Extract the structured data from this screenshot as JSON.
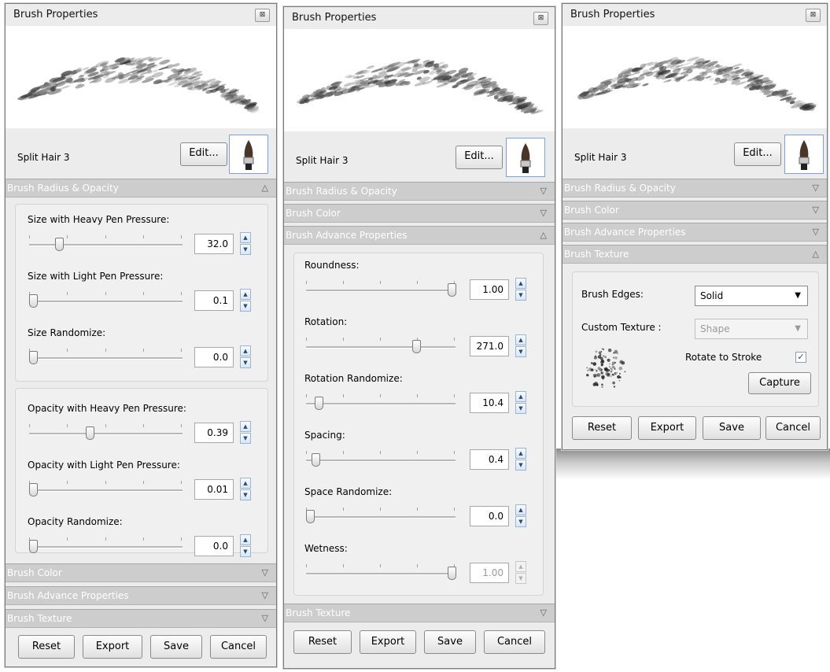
{
  "window_title": "Brush Properties",
  "brush_name": "Split Hair 3",
  "edit_label": "Edit...",
  "close_glyph": "⊠",
  "sections": {
    "radius": "Brush Radius & Opacity",
    "color": "Brush Color",
    "advance": "Brush Advance Properties",
    "texture": "Brush Texture"
  },
  "arrows": {
    "collapsed": "▽",
    "expanded": "△"
  },
  "buttons": {
    "reset": "Reset",
    "export": "Export",
    "save": "Save",
    "cancel": "Cancel"
  },
  "panel1": {
    "sliders": [
      {
        "label": "Size with Heavy Pen Pressure:",
        "value": "32.0",
        "level": 0.18
      },
      {
        "label": "Size with Light Pen Pressure:",
        "value": "0.1",
        "level": 0.0
      },
      {
        "label": "Size Randomize:",
        "value": "0.0",
        "level": 0.0
      },
      {
        "label": "Opacity with Heavy Pen Pressure:",
        "value": "0.39",
        "level": 0.39
      },
      {
        "label": "Opacity with Light Pen Pressure:",
        "value": "0.01",
        "level": 0.0
      },
      {
        "label": "Opacity Randomize:",
        "value": "0.0",
        "level": 0.0
      }
    ]
  },
  "panel2": {
    "sliders": [
      {
        "label": "Roundness:",
        "value": "1.00",
        "level": 1.0
      },
      {
        "label": "Rotation:",
        "value": "271.0",
        "level": 0.75
      },
      {
        "label": "Rotation Randomize:",
        "value": "10.4",
        "level": 0.06
      },
      {
        "label": "Spacing:",
        "value": "0.4",
        "level": 0.04
      },
      {
        "label": "Space Randomize:",
        "value": "0.0",
        "level": 0.0
      },
      {
        "label": "Wetness:",
        "value": "1.00",
        "level": 1.0,
        "disabled": true
      }
    ]
  },
  "panel3": {
    "edges_label": "Brush Edges:",
    "edges_value": "Solid",
    "custom_texture_label": "Custom Texture :",
    "custom_texture_value": "Shape",
    "rotate_label": "Rotate to Stroke",
    "rotate_checked": true,
    "check_glyph": "✓",
    "capture_label": "Capture"
  }
}
